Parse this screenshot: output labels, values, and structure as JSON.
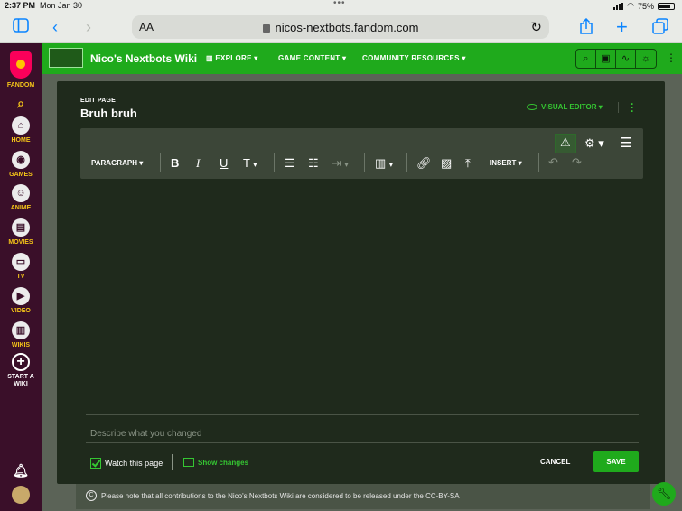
{
  "status": {
    "time": "2:37 PM",
    "date": "Mon Jan 30",
    "battery": "75%"
  },
  "browser": {
    "text_size": "AA",
    "url": "nicos-nextbots.fandom.com"
  },
  "rail": {
    "brand": "FANDOM",
    "items": [
      {
        "label": "HOME",
        "icon": "home-icon"
      },
      {
        "label": "GAMES",
        "icon": "gamepad-icon"
      },
      {
        "label": "ANIME",
        "icon": "anime-icon"
      },
      {
        "label": "MOVIES",
        "icon": "film-icon"
      },
      {
        "label": "TV",
        "icon": "tv-icon"
      },
      {
        "label": "VIDEO",
        "icon": "video-icon"
      },
      {
        "label": "WIKIS",
        "icon": "book-icon"
      }
    ],
    "start_wiki": "START A WIKI"
  },
  "wiki": {
    "title": "Nico's Nextbots Wiki",
    "nav": [
      "EXPLORE",
      "GAME CONTENT",
      "COMMUNITY RESOURCES"
    ]
  },
  "edit": {
    "kicker": "EDIT PAGE",
    "page_title": "Bruh bruh",
    "visual_editor": "VISUAL EDITOR",
    "toolbar": {
      "paragraph": "PARAGRAPH",
      "insert": "INSERT"
    },
    "summary_placeholder": "Describe what you changed",
    "watch_label": "Watch this page",
    "show_changes": "Show changes",
    "cancel": "CANCEL",
    "save": "SAVE"
  },
  "notice": "Please note that all contributions to the Nico's Nextbots Wiki are considered to be released under the CC-BY-SA",
  "colors": {
    "accent": "#1faa1c",
    "rail_bg": "#3a0f29",
    "editor_bg": "#1f2a1c",
    "rail_text": "#f5c518"
  }
}
